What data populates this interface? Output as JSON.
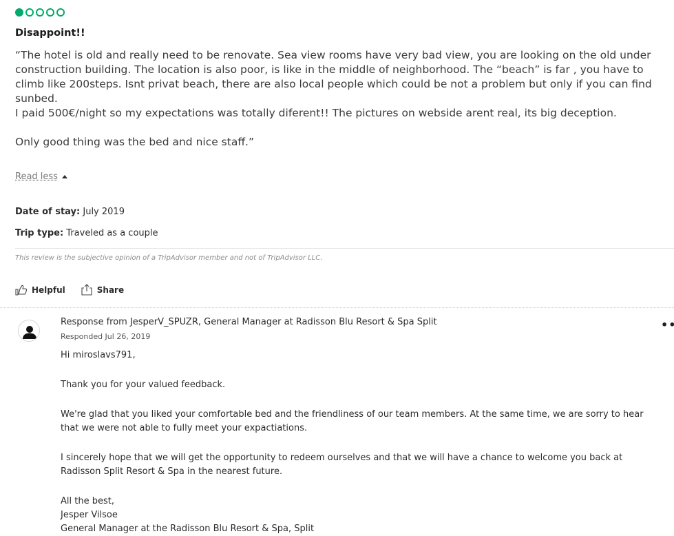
{
  "review": {
    "rating": {
      "filled": 1,
      "total": 5
    },
    "title": "Disappoint!!",
    "paragraphs": [
      "“The hotel is old and really need to be renovate. Sea view rooms have very bad view, you are looking on the old under construction building. The location is also poor, is like in the middle of neighborhood. The “beach” is far , you have to climb like 200steps. Isnt privat beach, there are also local people which could be not a problem but only if you can find sunbed.\nI paid 500€/night so my expectations was totally diferent!! The pictures on webside arent real, its big deception.",
      "Only good thing was the bed and nice staff.”"
    ],
    "read_less": "Read less",
    "date_of_stay_label": "Date of stay:",
    "date_of_stay": "July 2019",
    "trip_type_label": "Trip type:",
    "trip_type": "Traveled as a couple",
    "disclaimer": "This review is the subjective opinion of a TripAdvisor member and not of TripAdvisor LLC.",
    "helpful_label": "Helpful",
    "share_label": "Share"
  },
  "response": {
    "header": "Response from JesperV_SPUZR, General Manager at Radisson Blu Resort & Spa Split",
    "date": "Responded Jul 26, 2019",
    "greeting": "Hi miroslavs791,",
    "p1": "Thank you for your valued feedback.",
    "p2": "We're glad that you liked your comfortable bed and the friendliness of our team members. At the same time, we are sorry to hear that we were not able to fully meet your expactiations.",
    "p3": "I sincerely hope that we will get the opportunity to redeem ourselves and that we will have a chance to welcome you back at Radisson Split Resort & Spa in the nearest future.",
    "signoff": "All the best,",
    "name": "Jesper Vilsoe",
    "position": "General Manager at the Radisson Blu Resort & Spa, Split",
    "more_label": "••"
  },
  "colors": {
    "accent": "#00aa6c"
  },
  "icons": {
    "helpful": "thumbs-up-icon",
    "share": "share-icon",
    "avatar": "user-avatar-icon",
    "caret": "caret-up-icon"
  }
}
